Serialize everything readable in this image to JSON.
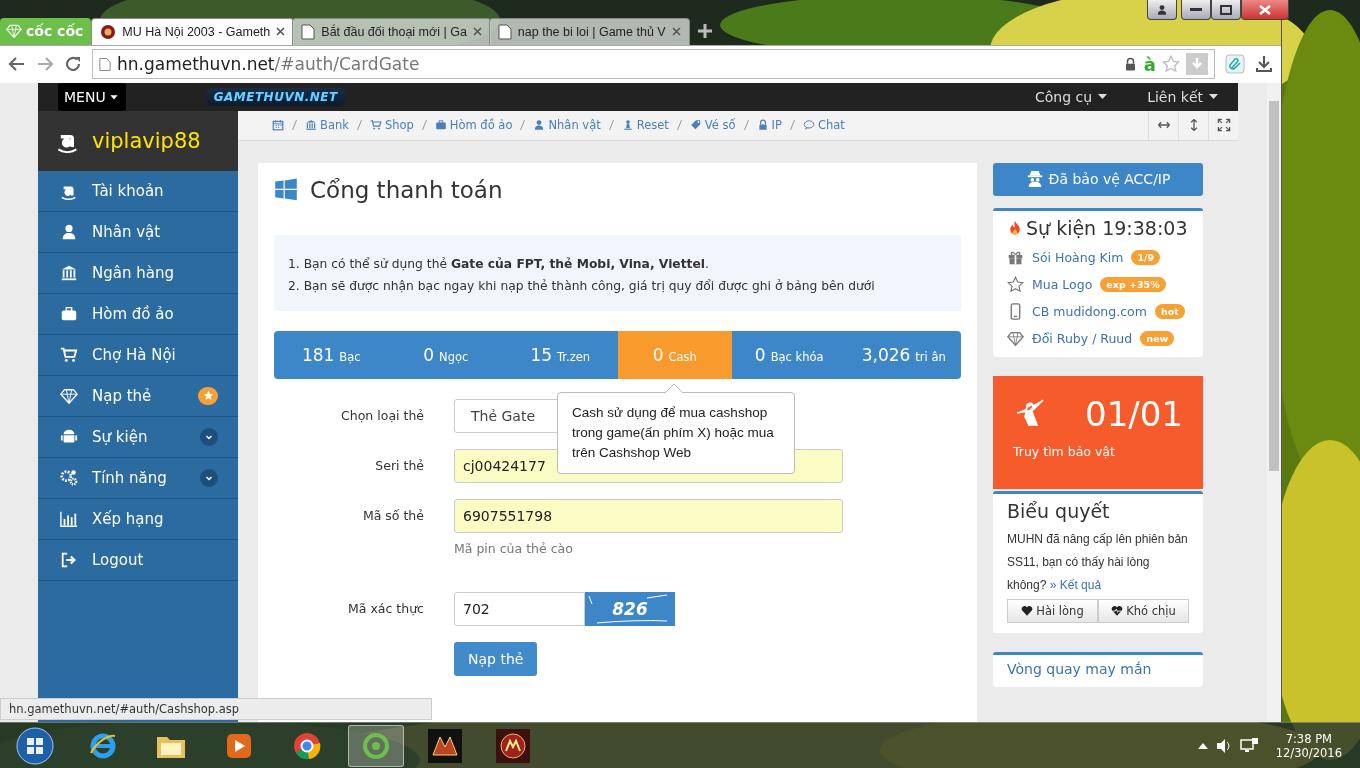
{
  "browser": {
    "brand": "cốc cốc",
    "tabs": [
      {
        "title": "MU Hà Nội 2003 - Gameth",
        "selected": true
      },
      {
        "title": "Bắt đầu đối thoại mới | Ga",
        "selected": false
      },
      {
        "title": "nap the bi loi | Game thủ V",
        "selected": false
      }
    ],
    "url_host": "hn.gamethuvn.net",
    "url_path": "/#auth/CardGate",
    "toolbar_glyph": "à",
    "status_url": "hn.gamethuvn.net/#auth/Cashshop.asp"
  },
  "navbar": {
    "menu": "MENU",
    "logo": "GAMETHUVN.NET",
    "links": [
      "Công cụ",
      "Liên kết"
    ]
  },
  "sidebar": {
    "username": "viplavip88",
    "items": [
      {
        "label": "Tài khoản",
        "kind": "plain"
      },
      {
        "label": "Nhân vật",
        "kind": "plain"
      },
      {
        "label": "Ngân hàng",
        "kind": "plain"
      },
      {
        "label": "Hòm đồ ảo",
        "kind": "plain"
      },
      {
        "label": "Chợ Hà Nội",
        "kind": "plain"
      },
      {
        "label": "Nạp thẻ",
        "kind": "badge"
      },
      {
        "label": "Sự kiện",
        "kind": "expand"
      },
      {
        "label": "Tính năng",
        "kind": "expand"
      },
      {
        "label": "Xếp hạng",
        "kind": "plain"
      },
      {
        "label": "Logout",
        "kind": "plain"
      }
    ]
  },
  "breadcrumb": [
    "Bank",
    "Shop",
    "Hòm đồ ảo",
    "Nhân vật",
    "Reset",
    "Vé số",
    "IP",
    "Chat"
  ],
  "main": {
    "title": "Cổng thanh toán",
    "notes": [
      "1. Bạn có thể sử dụng thẻ **Gate của FPT, thẻ Mobi, Vina, Viettel**.",
      "2. Bạn sẽ được nhận bạc ngay khi nạp thẻ thành công, giá trị quy đổi được ghi ở bảng bên dưới"
    ],
    "balances": [
      {
        "value": "181",
        "unit": "Bạc",
        "selected": false
      },
      {
        "value": "0",
        "unit": "Ngọc",
        "selected": false
      },
      {
        "value": "15",
        "unit": "Tr.zen",
        "selected": false
      },
      {
        "value": "0",
        "unit": "Cash",
        "selected": true
      },
      {
        "value": "0",
        "unit": "Bạc khóa",
        "selected": false
      },
      {
        "value": "3,026",
        "unit": "tri ân",
        "selected": false
      }
    ],
    "tooltip": "Cash sử dụng để mua cashshop trong game(ấn phím X) hoặc mua trên Cashshop Web",
    "fields": [
      {
        "label": "Chọn loại thẻ",
        "kind": "select",
        "value": "Thẻ Gate"
      },
      {
        "label": "Seri thẻ",
        "kind": "text",
        "value": "cj00424177"
      },
      {
        "label": "Mã số thẻ",
        "kind": "text",
        "value": "6907551798",
        "help": "Mã pin của thẻ cào"
      },
      {
        "label": "Mã xác thực",
        "kind": "captcha",
        "value": "702",
        "captcha": "826"
      }
    ],
    "submit": "Nạp thẻ"
  },
  "right": {
    "protect_button": "Đã bảo vệ ACC/IP",
    "events": {
      "title": "Sự kiện 19:38:03",
      "items": [
        {
          "label": "Sói Hoàng Kim",
          "tag": "1/9"
        },
        {
          "label": "Mua Logo",
          "tag": "exp +35%"
        },
        {
          "label": "CB mudidong.com",
          "tag": "hot"
        },
        {
          "label": "Đổi Ruby / Ruud",
          "tag": "new"
        }
      ]
    },
    "treasure": {
      "count": "01/01",
      "label": "Truy tìm bảo vật"
    },
    "poll": {
      "title": "Biểu quyết",
      "text": "MUHN đã nâng cấp lên phiên bản SS11, bạn có thấy hài lòng không?",
      "link": "» Kết quả",
      "buttons": [
        "Hài lòng",
        "Khó chịu"
      ]
    },
    "wheel": {
      "title": "Vòng quay may mắn"
    }
  },
  "taskbar": {
    "time": "7:38 PM",
    "date": "12/30/2016"
  }
}
